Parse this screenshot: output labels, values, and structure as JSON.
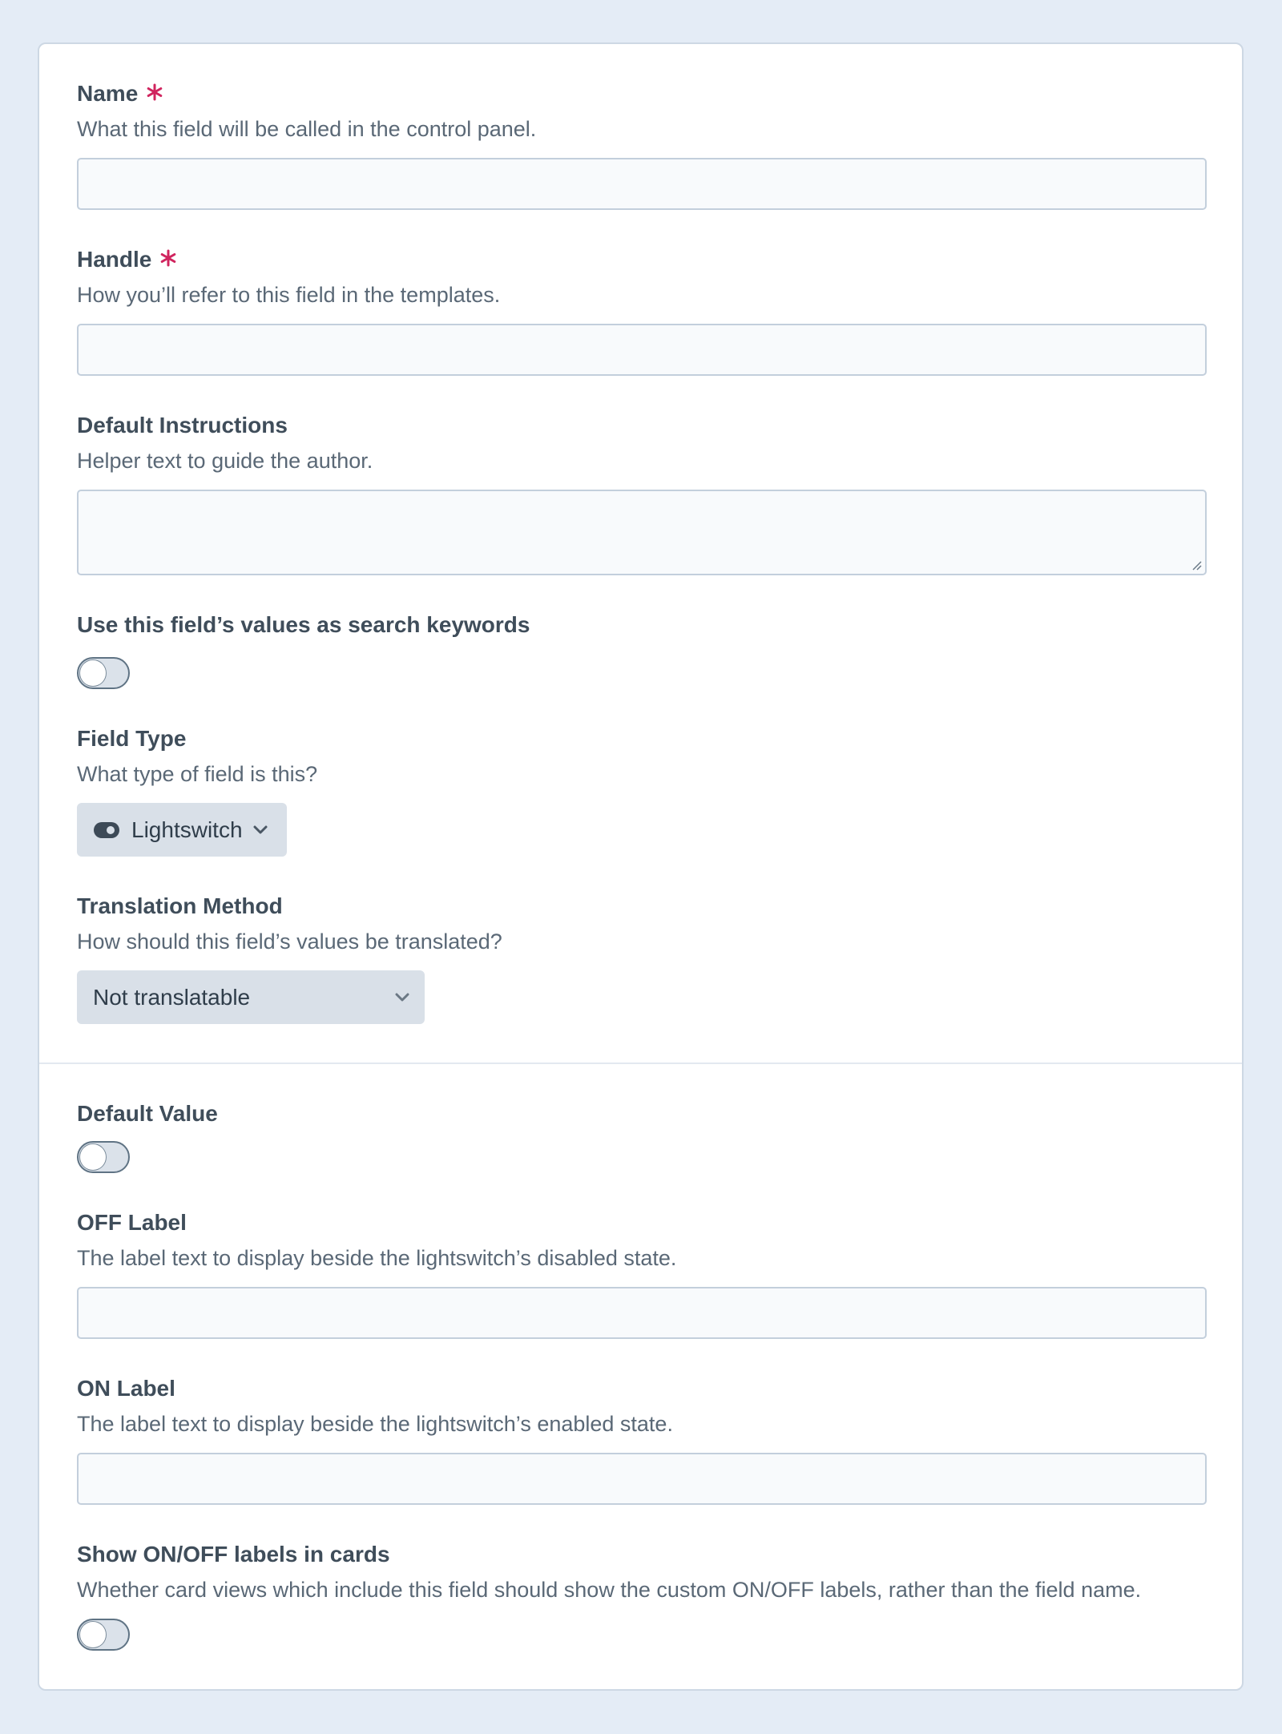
{
  "fields": {
    "name": {
      "label": "Name",
      "instructions": "What this field will be called in the control panel.",
      "value": ""
    },
    "handle": {
      "label": "Handle",
      "instructions": "How you’ll refer to this field in the templates.",
      "value": ""
    },
    "default_instructions": {
      "label": "Default Instructions",
      "instructions": "Helper text to guide the author.",
      "value": ""
    },
    "search_keywords": {
      "label": "Use this field’s values as search keywords",
      "on": false
    },
    "field_type": {
      "label": "Field Type",
      "instructions": "What type of field is this?",
      "selected": "Lightswitch",
      "icon": "lightswitch-icon"
    },
    "translation_method": {
      "label": "Translation Method",
      "instructions": "How should this field’s values be translated?",
      "selected": "Not translatable"
    },
    "default_value": {
      "label": "Default Value",
      "on": false
    },
    "off_label": {
      "label": "OFF Label",
      "instructions": "The label text to display beside the lightswitch’s disabled state.",
      "value": ""
    },
    "on_label": {
      "label": "ON Label",
      "instructions": "The label text to display beside the lightswitch’s enabled state.",
      "value": ""
    },
    "show_labels_in_cards": {
      "label": "Show ON/OFF labels in cards",
      "instructions": "Whether card views which include this field should show the custom ON/OFF labels, rather than the field name.",
      "on": false
    }
  },
  "colors": {
    "required_asterisk": "#d0245e",
    "page_background": "#e4ecf6",
    "select_background": "#d9e0e8"
  }
}
